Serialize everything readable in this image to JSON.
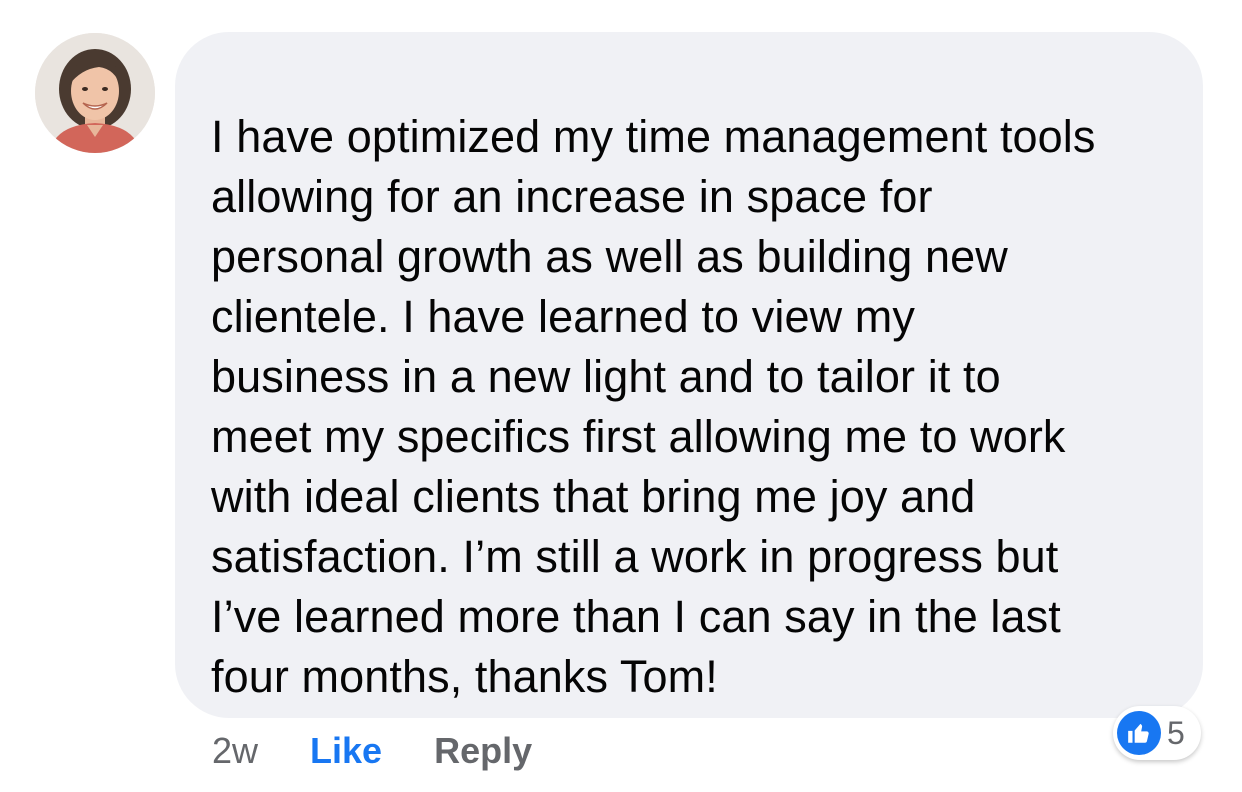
{
  "comment": {
    "text": "I have optimized my time management tools\nallowing for an increase in space for\npersonal growth as well as building new\nclientele. I have learned to view my\nbusiness in a new light and to tailor it to\nmeet my specifics first allowing me to work\nwith ideal clients that bring me joy and\nsatisfaction. I’m still a work in progress but\nI’ve learned more than I can say in the last\nfour months, thanks Tom!",
    "timestamp": "2w",
    "like_label": "Like",
    "reply_label": "Reply",
    "reaction_count": "5",
    "reaction_icon": "thumbs-up-icon"
  },
  "colors": {
    "bubble_bg": "#f0f1f5",
    "link_blue": "#1877f2",
    "muted_gray": "#65676b"
  }
}
